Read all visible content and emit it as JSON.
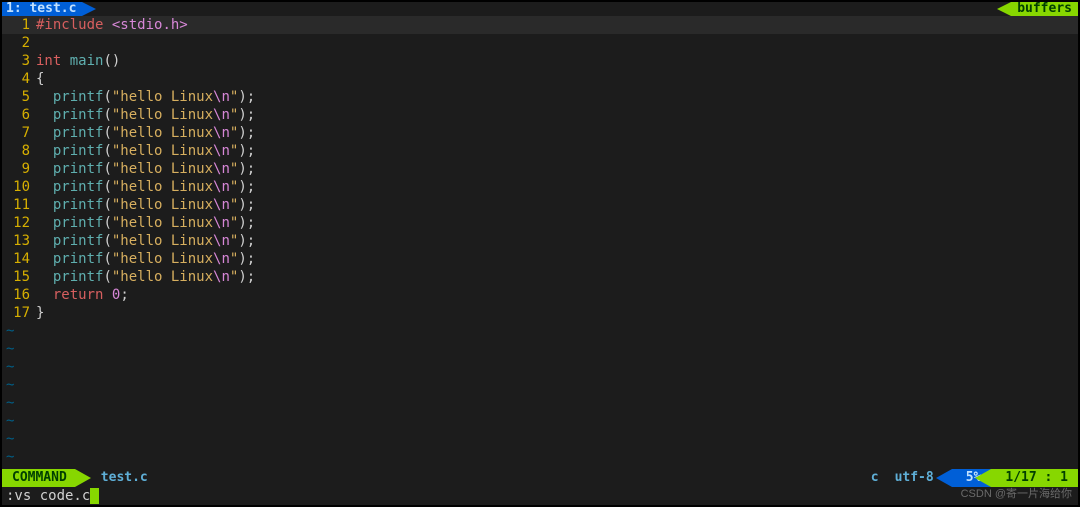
{
  "topbar": {
    "tab": "1: test.c",
    "right": "buffers"
  },
  "code": {
    "lines": [
      {
        "n": 1,
        "current": true,
        "tokens": [
          [
            "pre",
            "#include"
          ],
          [
            "p",
            " "
          ],
          [
            "inc",
            "<stdio.h>"
          ]
        ]
      },
      {
        "n": 2,
        "tokens": []
      },
      {
        "n": 3,
        "tokens": [
          [
            "kw",
            "int"
          ],
          [
            "p",
            " "
          ],
          [
            "fn",
            "main"
          ],
          [
            "p",
            "()"
          ]
        ]
      },
      {
        "n": 4,
        "tokens": [
          [
            "p",
            "{"
          ]
        ]
      },
      {
        "n": 5,
        "tokens": [
          [
            "p",
            "  "
          ],
          [
            "fn",
            "printf"
          ],
          [
            "p",
            "("
          ],
          [
            "str",
            "\"hello Linux"
          ],
          [
            "esc",
            "\\n"
          ],
          [
            "str",
            "\""
          ],
          [
            "p",
            ");"
          ]
        ]
      },
      {
        "n": 6,
        "tokens": [
          [
            "p",
            "  "
          ],
          [
            "fn",
            "printf"
          ],
          [
            "p",
            "("
          ],
          [
            "str",
            "\"hello Linux"
          ],
          [
            "esc",
            "\\n"
          ],
          [
            "str",
            "\""
          ],
          [
            "p",
            ");"
          ]
        ]
      },
      {
        "n": 7,
        "tokens": [
          [
            "p",
            "  "
          ],
          [
            "fn",
            "printf"
          ],
          [
            "p",
            "("
          ],
          [
            "str",
            "\"hello Linux"
          ],
          [
            "esc",
            "\\n"
          ],
          [
            "str",
            "\""
          ],
          [
            "p",
            ");"
          ]
        ]
      },
      {
        "n": 8,
        "tokens": [
          [
            "p",
            "  "
          ],
          [
            "fn",
            "printf"
          ],
          [
            "p",
            "("
          ],
          [
            "str",
            "\"hello Linux"
          ],
          [
            "esc",
            "\\n"
          ],
          [
            "str",
            "\""
          ],
          [
            "p",
            ");"
          ]
        ]
      },
      {
        "n": 9,
        "tokens": [
          [
            "p",
            "  "
          ],
          [
            "fn",
            "printf"
          ],
          [
            "p",
            "("
          ],
          [
            "str",
            "\"hello Linux"
          ],
          [
            "esc",
            "\\n"
          ],
          [
            "str",
            "\""
          ],
          [
            "p",
            ");"
          ]
        ]
      },
      {
        "n": 10,
        "tokens": [
          [
            "p",
            "  "
          ],
          [
            "fn",
            "printf"
          ],
          [
            "p",
            "("
          ],
          [
            "str",
            "\"hello Linux"
          ],
          [
            "esc",
            "\\n"
          ],
          [
            "str",
            "\""
          ],
          [
            "p",
            ");"
          ]
        ]
      },
      {
        "n": 11,
        "tokens": [
          [
            "p",
            "  "
          ],
          [
            "fn",
            "printf"
          ],
          [
            "p",
            "("
          ],
          [
            "str",
            "\"hello Linux"
          ],
          [
            "esc",
            "\\n"
          ],
          [
            "str",
            "\""
          ],
          [
            "p",
            ");"
          ]
        ]
      },
      {
        "n": 12,
        "tokens": [
          [
            "p",
            "  "
          ],
          [
            "fn",
            "printf"
          ],
          [
            "p",
            "("
          ],
          [
            "str",
            "\"hello Linux"
          ],
          [
            "esc",
            "\\n"
          ],
          [
            "str",
            "\""
          ],
          [
            "p",
            ");"
          ]
        ]
      },
      {
        "n": 13,
        "tokens": [
          [
            "p",
            "  "
          ],
          [
            "fn",
            "printf"
          ],
          [
            "p",
            "("
          ],
          [
            "str",
            "\"hello Linux"
          ],
          [
            "esc",
            "\\n"
          ],
          [
            "str",
            "\""
          ],
          [
            "p",
            ");"
          ]
        ]
      },
      {
        "n": 14,
        "tokens": [
          [
            "p",
            "  "
          ],
          [
            "fn",
            "printf"
          ],
          [
            "p",
            "("
          ],
          [
            "str",
            "\"hello Linux"
          ],
          [
            "esc",
            "\\n"
          ],
          [
            "str",
            "\""
          ],
          [
            "p",
            ");"
          ]
        ]
      },
      {
        "n": 15,
        "tokens": [
          [
            "p",
            "  "
          ],
          [
            "fn",
            "printf"
          ],
          [
            "p",
            "("
          ],
          [
            "str",
            "\"hello Linux"
          ],
          [
            "esc",
            "\\n"
          ],
          [
            "str",
            "\""
          ],
          [
            "p",
            ");"
          ]
        ]
      },
      {
        "n": 16,
        "tokens": [
          [
            "p",
            "  "
          ],
          [
            "kw",
            "return"
          ],
          [
            "p",
            " "
          ],
          [
            "num",
            "0"
          ],
          [
            "p",
            ";"
          ]
        ]
      },
      {
        "n": 17,
        "tokens": [
          [
            "p",
            "}"
          ]
        ]
      }
    ],
    "tilde_rows": 8
  },
  "status": {
    "mode": "COMMAND",
    "file": "test.c",
    "filetype": "c",
    "encoding": "utf-8",
    "percent": "5%",
    "position": "1/17 :  1"
  },
  "cmdline": ":vs code.c",
  "watermark": "CSDN @寄一片海给你"
}
